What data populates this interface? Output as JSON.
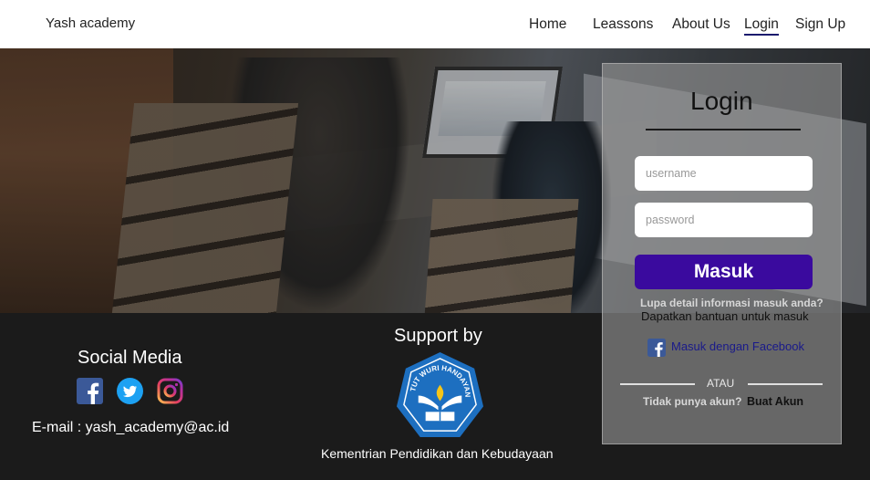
{
  "header": {
    "brand": "Yash academy",
    "nav": [
      {
        "label": "Home"
      },
      {
        "label": "Leassons"
      },
      {
        "label": "About Us"
      },
      {
        "label": "Login",
        "active": true
      },
      {
        "label": "Sign Up"
      }
    ]
  },
  "login": {
    "title": "Login",
    "username_placeholder": "username",
    "password_placeholder": "password",
    "submit_label": "Masuk",
    "forgot_text": "Lupa detail informasi masuk anda?",
    "help_text": "Dapatkan bantuan untuk masuk",
    "facebook_label": "Masuk dengan Facebook",
    "divider_text": "ATAU",
    "no_account_text": "Tidak punya akun?",
    "signup_link": "Buat Akun"
  },
  "footer": {
    "social_title": "Social Media",
    "social_icons": [
      "facebook-icon",
      "twitter-icon",
      "instagram-icon"
    ],
    "email": "E-mail : yash_academy@ac.id",
    "support_title": "Support by",
    "logo_text": "TUT WURI HANDAYANI",
    "ministry": "Kementrian Pendidikan dan Kebudayaan"
  },
  "colors": {
    "header_bg": "#ffffff",
    "footer_bg": "#1b1b1b",
    "submit_button": "#3a0a9e",
    "nav_active_underline": "#1b1b6e",
    "facebook_blue": "#3b5998",
    "twitter_blue": "#1da1f2"
  }
}
